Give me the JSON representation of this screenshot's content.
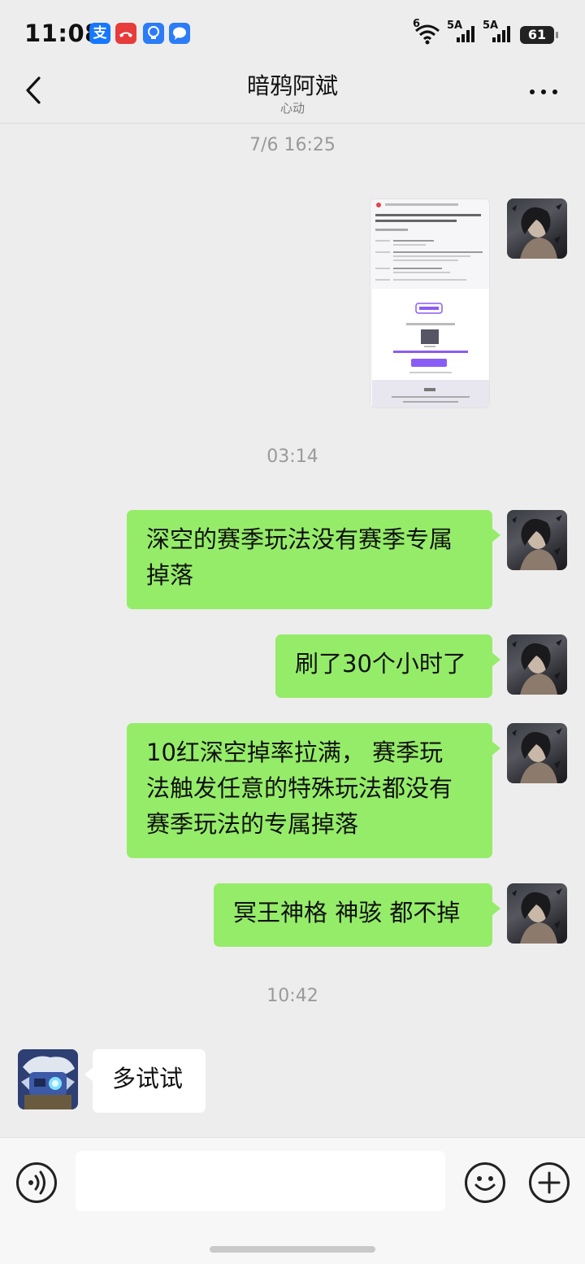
{
  "status_bar": {
    "time": "11:08",
    "notification_icons": [
      {
        "name": "alipay-icon",
        "glyph": "支",
        "color": "#1677ff"
      },
      {
        "name": "missed-call-icon",
        "glyph": "✆",
        "color": "#e83b3b"
      },
      {
        "name": "bulb-app-icon",
        "glyph": "●",
        "color": "#2b7cf6"
      },
      {
        "name": "message-app-icon",
        "glyph": "●",
        "color": "#2b7cf6"
      }
    ],
    "wifi_label": "6",
    "signal_1_label": "5A",
    "signal_2_label": "5A",
    "battery_level": "61"
  },
  "header": {
    "title": "暗鸦阿斌",
    "subtitle": "心动"
  },
  "messages": {
    "timestamp_1": "7/6 16:25",
    "timestamp_2": "03:14",
    "timestamp_3": "10:42",
    "msg_1_line_1": "深空的赛季玩法没有赛季专属",
    "msg_1_line_2": "掉落",
    "msg_2": "刷了30个小时了",
    "msg_3_line_1": "10红深空掉率拉满， 赛季玩",
    "msg_3_line_2": "法触发任意的特殊玩法都没有",
    "msg_3_line_3": "赛季玩法的专属掉落",
    "msg_4": "冥王神格 神骇 都不掉",
    "msg_5": "多试试"
  },
  "colors": {
    "background": "#ededed",
    "outgoing_bubble": "#95ec69",
    "incoming_bubble": "#ffffff",
    "accent_purple": "#8a5cf6"
  }
}
